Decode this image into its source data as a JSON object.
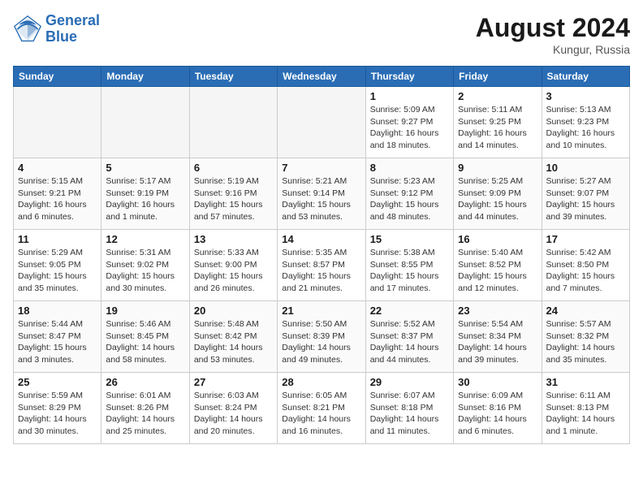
{
  "header": {
    "logo_line1": "General",
    "logo_line2": "Blue",
    "month_year": "August 2024",
    "location": "Kungur, Russia"
  },
  "weekdays": [
    "Sunday",
    "Monday",
    "Tuesday",
    "Wednesday",
    "Thursday",
    "Friday",
    "Saturday"
  ],
  "weeks": [
    [
      {
        "day": "",
        "info": ""
      },
      {
        "day": "",
        "info": ""
      },
      {
        "day": "",
        "info": ""
      },
      {
        "day": "",
        "info": ""
      },
      {
        "day": "1",
        "info": "Sunrise: 5:09 AM\nSunset: 9:27 PM\nDaylight: 16 hours\nand 18 minutes."
      },
      {
        "day": "2",
        "info": "Sunrise: 5:11 AM\nSunset: 9:25 PM\nDaylight: 16 hours\nand 14 minutes."
      },
      {
        "day": "3",
        "info": "Sunrise: 5:13 AM\nSunset: 9:23 PM\nDaylight: 16 hours\nand 10 minutes."
      }
    ],
    [
      {
        "day": "4",
        "info": "Sunrise: 5:15 AM\nSunset: 9:21 PM\nDaylight: 16 hours\nand 6 minutes."
      },
      {
        "day": "5",
        "info": "Sunrise: 5:17 AM\nSunset: 9:19 PM\nDaylight: 16 hours\nand 1 minute."
      },
      {
        "day": "6",
        "info": "Sunrise: 5:19 AM\nSunset: 9:16 PM\nDaylight: 15 hours\nand 57 minutes."
      },
      {
        "day": "7",
        "info": "Sunrise: 5:21 AM\nSunset: 9:14 PM\nDaylight: 15 hours\nand 53 minutes."
      },
      {
        "day": "8",
        "info": "Sunrise: 5:23 AM\nSunset: 9:12 PM\nDaylight: 15 hours\nand 48 minutes."
      },
      {
        "day": "9",
        "info": "Sunrise: 5:25 AM\nSunset: 9:09 PM\nDaylight: 15 hours\nand 44 minutes."
      },
      {
        "day": "10",
        "info": "Sunrise: 5:27 AM\nSunset: 9:07 PM\nDaylight: 15 hours\nand 39 minutes."
      }
    ],
    [
      {
        "day": "11",
        "info": "Sunrise: 5:29 AM\nSunset: 9:05 PM\nDaylight: 15 hours\nand 35 minutes."
      },
      {
        "day": "12",
        "info": "Sunrise: 5:31 AM\nSunset: 9:02 PM\nDaylight: 15 hours\nand 30 minutes."
      },
      {
        "day": "13",
        "info": "Sunrise: 5:33 AM\nSunset: 9:00 PM\nDaylight: 15 hours\nand 26 minutes."
      },
      {
        "day": "14",
        "info": "Sunrise: 5:35 AM\nSunset: 8:57 PM\nDaylight: 15 hours\nand 21 minutes."
      },
      {
        "day": "15",
        "info": "Sunrise: 5:38 AM\nSunset: 8:55 PM\nDaylight: 15 hours\nand 17 minutes."
      },
      {
        "day": "16",
        "info": "Sunrise: 5:40 AM\nSunset: 8:52 PM\nDaylight: 15 hours\nand 12 minutes."
      },
      {
        "day": "17",
        "info": "Sunrise: 5:42 AM\nSunset: 8:50 PM\nDaylight: 15 hours\nand 7 minutes."
      }
    ],
    [
      {
        "day": "18",
        "info": "Sunrise: 5:44 AM\nSunset: 8:47 PM\nDaylight: 15 hours\nand 3 minutes."
      },
      {
        "day": "19",
        "info": "Sunrise: 5:46 AM\nSunset: 8:45 PM\nDaylight: 14 hours\nand 58 minutes."
      },
      {
        "day": "20",
        "info": "Sunrise: 5:48 AM\nSunset: 8:42 PM\nDaylight: 14 hours\nand 53 minutes."
      },
      {
        "day": "21",
        "info": "Sunrise: 5:50 AM\nSunset: 8:39 PM\nDaylight: 14 hours\nand 49 minutes."
      },
      {
        "day": "22",
        "info": "Sunrise: 5:52 AM\nSunset: 8:37 PM\nDaylight: 14 hours\nand 44 minutes."
      },
      {
        "day": "23",
        "info": "Sunrise: 5:54 AM\nSunset: 8:34 PM\nDaylight: 14 hours\nand 39 minutes."
      },
      {
        "day": "24",
        "info": "Sunrise: 5:57 AM\nSunset: 8:32 PM\nDaylight: 14 hours\nand 35 minutes."
      }
    ],
    [
      {
        "day": "25",
        "info": "Sunrise: 5:59 AM\nSunset: 8:29 PM\nDaylight: 14 hours\nand 30 minutes."
      },
      {
        "day": "26",
        "info": "Sunrise: 6:01 AM\nSunset: 8:26 PM\nDaylight: 14 hours\nand 25 minutes."
      },
      {
        "day": "27",
        "info": "Sunrise: 6:03 AM\nSunset: 8:24 PM\nDaylight: 14 hours\nand 20 minutes."
      },
      {
        "day": "28",
        "info": "Sunrise: 6:05 AM\nSunset: 8:21 PM\nDaylight: 14 hours\nand 16 minutes."
      },
      {
        "day": "29",
        "info": "Sunrise: 6:07 AM\nSunset: 8:18 PM\nDaylight: 14 hours\nand 11 minutes."
      },
      {
        "day": "30",
        "info": "Sunrise: 6:09 AM\nSunset: 8:16 PM\nDaylight: 14 hours\nand 6 minutes."
      },
      {
        "day": "31",
        "info": "Sunrise: 6:11 AM\nSunset: 8:13 PM\nDaylight: 14 hours\nand 1 minute."
      }
    ]
  ]
}
